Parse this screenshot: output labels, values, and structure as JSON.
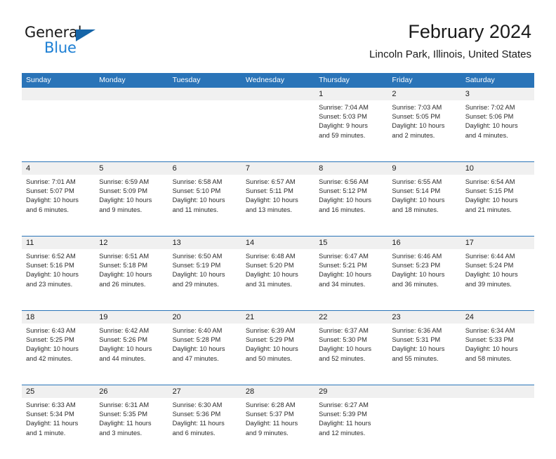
{
  "brand": {
    "name_part1": "General",
    "name_part2": "Blue",
    "triangle_icon": "blue-triangle-icon",
    "color_dark": "#1a1a1a",
    "color_blue": "#1c7fd4"
  },
  "header": {
    "title": "February 2024",
    "subtitle": "Lincoln Park, Illinois, United States"
  },
  "theme": {
    "header_blue": "#2a74b8",
    "band_gray": "#f0f0f0",
    "text": "#1a1a1a"
  },
  "calendar": {
    "weekdays": [
      "Sunday",
      "Monday",
      "Tuesday",
      "Wednesday",
      "Thursday",
      "Friday",
      "Saturday"
    ],
    "weeks": [
      {
        "days": [
          {
            "number": "",
            "sunrise": "",
            "sunset": "",
            "daylight1": "",
            "daylight2": ""
          },
          {
            "number": "",
            "sunrise": "",
            "sunset": "",
            "daylight1": "",
            "daylight2": ""
          },
          {
            "number": "",
            "sunrise": "",
            "sunset": "",
            "daylight1": "",
            "daylight2": ""
          },
          {
            "number": "",
            "sunrise": "",
            "sunset": "",
            "daylight1": "",
            "daylight2": ""
          },
          {
            "number": "1",
            "sunrise": "Sunrise: 7:04 AM",
            "sunset": "Sunset: 5:03 PM",
            "daylight1": "Daylight: 9 hours",
            "daylight2": "and 59 minutes."
          },
          {
            "number": "2",
            "sunrise": "Sunrise: 7:03 AM",
            "sunset": "Sunset: 5:05 PM",
            "daylight1": "Daylight: 10 hours",
            "daylight2": "and 2 minutes."
          },
          {
            "number": "3",
            "sunrise": "Sunrise: 7:02 AM",
            "sunset": "Sunset: 5:06 PM",
            "daylight1": "Daylight: 10 hours",
            "daylight2": "and 4 minutes."
          }
        ]
      },
      {
        "days": [
          {
            "number": "4",
            "sunrise": "Sunrise: 7:01 AM",
            "sunset": "Sunset: 5:07 PM",
            "daylight1": "Daylight: 10 hours",
            "daylight2": "and 6 minutes."
          },
          {
            "number": "5",
            "sunrise": "Sunrise: 6:59 AM",
            "sunset": "Sunset: 5:09 PM",
            "daylight1": "Daylight: 10 hours",
            "daylight2": "and 9 minutes."
          },
          {
            "number": "6",
            "sunrise": "Sunrise: 6:58 AM",
            "sunset": "Sunset: 5:10 PM",
            "daylight1": "Daylight: 10 hours",
            "daylight2": "and 11 minutes."
          },
          {
            "number": "7",
            "sunrise": "Sunrise: 6:57 AM",
            "sunset": "Sunset: 5:11 PM",
            "daylight1": "Daylight: 10 hours",
            "daylight2": "and 13 minutes."
          },
          {
            "number": "8",
            "sunrise": "Sunrise: 6:56 AM",
            "sunset": "Sunset: 5:12 PM",
            "daylight1": "Daylight: 10 hours",
            "daylight2": "and 16 minutes."
          },
          {
            "number": "9",
            "sunrise": "Sunrise: 6:55 AM",
            "sunset": "Sunset: 5:14 PM",
            "daylight1": "Daylight: 10 hours",
            "daylight2": "and 18 minutes."
          },
          {
            "number": "10",
            "sunrise": "Sunrise: 6:54 AM",
            "sunset": "Sunset: 5:15 PM",
            "daylight1": "Daylight: 10 hours",
            "daylight2": "and 21 minutes."
          }
        ]
      },
      {
        "days": [
          {
            "number": "11",
            "sunrise": "Sunrise: 6:52 AM",
            "sunset": "Sunset: 5:16 PM",
            "daylight1": "Daylight: 10 hours",
            "daylight2": "and 23 minutes."
          },
          {
            "number": "12",
            "sunrise": "Sunrise: 6:51 AM",
            "sunset": "Sunset: 5:18 PM",
            "daylight1": "Daylight: 10 hours",
            "daylight2": "and 26 minutes."
          },
          {
            "number": "13",
            "sunrise": "Sunrise: 6:50 AM",
            "sunset": "Sunset: 5:19 PM",
            "daylight1": "Daylight: 10 hours",
            "daylight2": "and 29 minutes."
          },
          {
            "number": "14",
            "sunrise": "Sunrise: 6:48 AM",
            "sunset": "Sunset: 5:20 PM",
            "daylight1": "Daylight: 10 hours",
            "daylight2": "and 31 minutes."
          },
          {
            "number": "15",
            "sunrise": "Sunrise: 6:47 AM",
            "sunset": "Sunset: 5:21 PM",
            "daylight1": "Daylight: 10 hours",
            "daylight2": "and 34 minutes."
          },
          {
            "number": "16",
            "sunrise": "Sunrise: 6:46 AM",
            "sunset": "Sunset: 5:23 PM",
            "daylight1": "Daylight: 10 hours",
            "daylight2": "and 36 minutes."
          },
          {
            "number": "17",
            "sunrise": "Sunrise: 6:44 AM",
            "sunset": "Sunset: 5:24 PM",
            "daylight1": "Daylight: 10 hours",
            "daylight2": "and 39 minutes."
          }
        ]
      },
      {
        "days": [
          {
            "number": "18",
            "sunrise": "Sunrise: 6:43 AM",
            "sunset": "Sunset: 5:25 PM",
            "daylight1": "Daylight: 10 hours",
            "daylight2": "and 42 minutes."
          },
          {
            "number": "19",
            "sunrise": "Sunrise: 6:42 AM",
            "sunset": "Sunset: 5:26 PM",
            "daylight1": "Daylight: 10 hours",
            "daylight2": "and 44 minutes."
          },
          {
            "number": "20",
            "sunrise": "Sunrise: 6:40 AM",
            "sunset": "Sunset: 5:28 PM",
            "daylight1": "Daylight: 10 hours",
            "daylight2": "and 47 minutes."
          },
          {
            "number": "21",
            "sunrise": "Sunrise: 6:39 AM",
            "sunset": "Sunset: 5:29 PM",
            "daylight1": "Daylight: 10 hours",
            "daylight2": "and 50 minutes."
          },
          {
            "number": "22",
            "sunrise": "Sunrise: 6:37 AM",
            "sunset": "Sunset: 5:30 PM",
            "daylight1": "Daylight: 10 hours",
            "daylight2": "and 52 minutes."
          },
          {
            "number": "23",
            "sunrise": "Sunrise: 6:36 AM",
            "sunset": "Sunset: 5:31 PM",
            "daylight1": "Daylight: 10 hours",
            "daylight2": "and 55 minutes."
          },
          {
            "number": "24",
            "sunrise": "Sunrise: 6:34 AM",
            "sunset": "Sunset: 5:33 PM",
            "daylight1": "Daylight: 10 hours",
            "daylight2": "and 58 minutes."
          }
        ]
      },
      {
        "days": [
          {
            "number": "25",
            "sunrise": "Sunrise: 6:33 AM",
            "sunset": "Sunset: 5:34 PM",
            "daylight1": "Daylight: 11 hours",
            "daylight2": "and 1 minute."
          },
          {
            "number": "26",
            "sunrise": "Sunrise: 6:31 AM",
            "sunset": "Sunset: 5:35 PM",
            "daylight1": "Daylight: 11 hours",
            "daylight2": "and 3 minutes."
          },
          {
            "number": "27",
            "sunrise": "Sunrise: 6:30 AM",
            "sunset": "Sunset: 5:36 PM",
            "daylight1": "Daylight: 11 hours",
            "daylight2": "and 6 minutes."
          },
          {
            "number": "28",
            "sunrise": "Sunrise: 6:28 AM",
            "sunset": "Sunset: 5:37 PM",
            "daylight1": "Daylight: 11 hours",
            "daylight2": "and 9 minutes."
          },
          {
            "number": "29",
            "sunrise": "Sunrise: 6:27 AM",
            "sunset": "Sunset: 5:39 PM",
            "daylight1": "Daylight: 11 hours",
            "daylight2": "and 12 minutes."
          },
          {
            "number": "",
            "sunrise": "",
            "sunset": "",
            "daylight1": "",
            "daylight2": ""
          },
          {
            "number": "",
            "sunrise": "",
            "sunset": "",
            "daylight1": "",
            "daylight2": ""
          }
        ]
      }
    ]
  }
}
